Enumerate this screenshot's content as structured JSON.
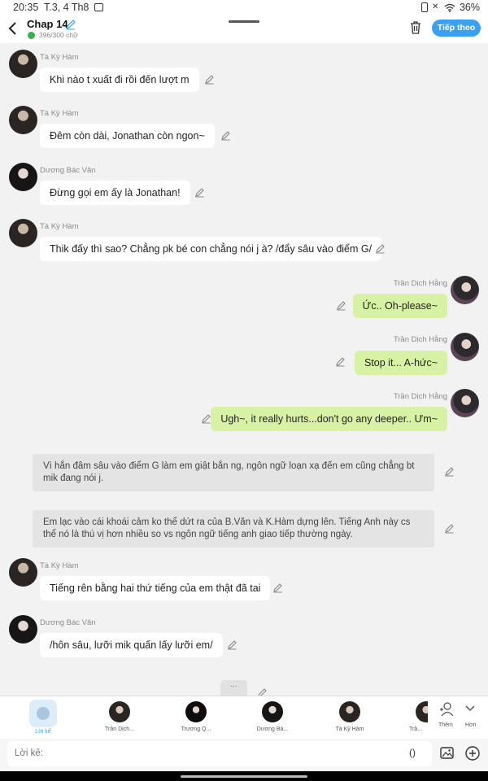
{
  "status_bar": {
    "time": "20:35",
    "date": "T.3, 4 Th8",
    "battery": "36%"
  },
  "header": {
    "title": "Chap 14",
    "word_count": "396/300 chữ",
    "next_label": "Tiếp theo"
  },
  "messages": [
    {
      "sender": "Tà Kỳ Hàm",
      "text": "Khi nào t xuất đi rồi đến lượt m"
    },
    {
      "sender": "Tà Kỳ Hàm",
      "text": "Đêm còn dài, Jonathan còn ngon~"
    },
    {
      "sender": "Dương Bác Văn",
      "text": "Đừng gọi em ấy là Jonathan!"
    },
    {
      "sender": "Tà Kỳ Hàm",
      "text": "Thik đấy thì sao? Chẳng pk bé con chẳng nói j à? /đẩy sâu vào điểm G/"
    },
    {
      "sender": "Trần Dịch Hằng",
      "text": "Ức.. Oh-please~"
    },
    {
      "sender": "Trần Dịch Hằng",
      "text": "Stop it... A-hức~"
    },
    {
      "sender": "Trần Dịch Hằng",
      "text": "Ugh~, it really hurts...don't go any deeper.. Ưm~"
    },
    {
      "sender": "",
      "text": "Vì hắn đâm sâu vào điểm G làm em giật bắn ng, ngôn ngữ loạn xạ đến em cũng chẳng bt mik đang nói j."
    },
    {
      "sender": "",
      "text": "Em lạc vào cái khoái cảm ko thể dứt ra của B.Văn và K.Hàm dựng lên. Tiếng Anh này cs thể nó là thú vị hơn nhiều so vs ngôn ngữ tiếng anh giao tiếp thường ngày."
    },
    {
      "sender": "Tà Kỳ Hàm",
      "text": "Tiếng rên bằng hai thứ tiếng của em thật đã tai"
    },
    {
      "sender": "Dương Bác Văn",
      "text": "/hôn sâu, lưỡi mik quấn lấy lưỡi em/"
    }
  ],
  "more_indicator": "...",
  "characters": [
    {
      "name": "Lời kể"
    },
    {
      "name": "Trần Dịch..."
    },
    {
      "name": "Trương Q..."
    },
    {
      "name": "Dương Bá..."
    },
    {
      "name": "Tà Kỳ Hàm"
    },
    {
      "name": "Trầ..."
    }
  ],
  "char_actions": {
    "add_label": "Thêm",
    "more_label": "Hơn"
  },
  "input": {
    "placeholder": "Lời kể:",
    "paren": "()"
  }
}
